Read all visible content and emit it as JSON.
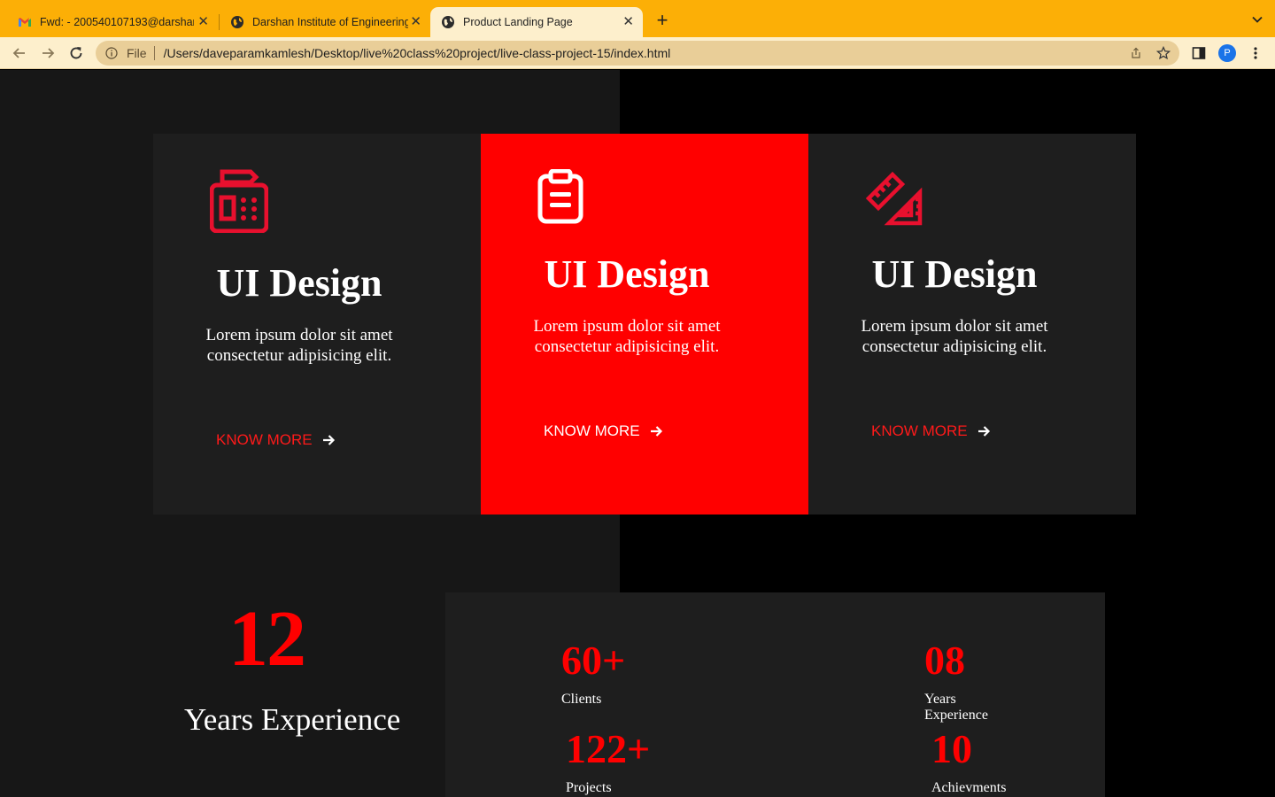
{
  "browser": {
    "tabs": [
      {
        "title": "Fwd: - 200540107193@darshan.ac.in",
        "favicon": "gmail-icon",
        "active": false
      },
      {
        "title": "Darshan Institute of Engineering",
        "favicon": "globe-icon",
        "active": false
      },
      {
        "title": "Product Landing Page",
        "favicon": "globe-icon",
        "active": true
      }
    ],
    "new_tab": "+",
    "address": {
      "scheme_label": "File",
      "url": "/Users/daveparamkamlesh/Desktop/live%20class%20project/live-class-project-15/index.html"
    },
    "profile_initial": "P",
    "colors": {
      "tabbar": "#fcaf06",
      "toolbar": "#fdefcc",
      "omnibox": "#e9ce98",
      "profile": "#1a73e8"
    }
  },
  "services": {
    "cards": [
      {
        "icon": "fax-machine-icon",
        "title": "UI Design",
        "text": "Lorem ipsum dolor sit amet consectetur adipisicing elit.",
        "link": "KNOW MORE"
      },
      {
        "icon": "clipboard-icon",
        "title": "UI Design",
        "text": "Lorem ipsum dolor sit amet consectetur adipisicing elit.",
        "link": "KNOW MORE"
      },
      {
        "icon": "ruler-triangle-icon",
        "title": "UI Design",
        "text": "Lorem ipsum dolor sit amet consectetur adipisicing elit.",
        "link": "KNOW MORE"
      }
    ],
    "colors": {
      "accent": "#ff0000",
      "card": "#1e1e1e",
      "background_left": "#171717",
      "background_right": "#000000"
    }
  },
  "experience": {
    "years": "12",
    "label": "Years Experience",
    "stats": [
      {
        "value": "60+",
        "label": "Clients"
      },
      {
        "value": "08",
        "label": "Years Experience"
      },
      {
        "value": "122+",
        "label": "Projects"
      },
      {
        "value": "10",
        "label": "Achievments"
      }
    ]
  }
}
